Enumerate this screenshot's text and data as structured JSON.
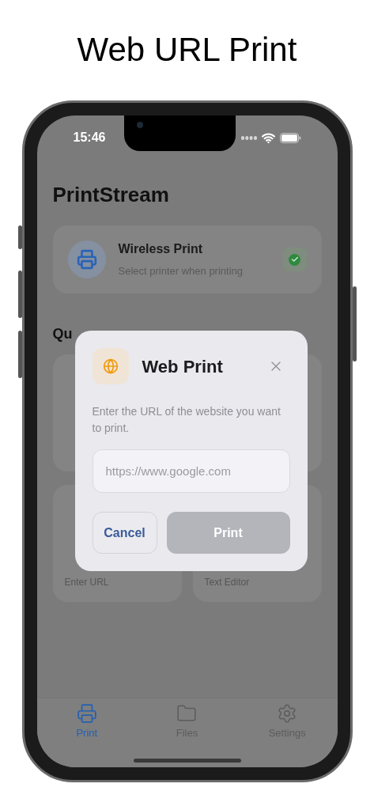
{
  "page_title": "Web URL Print",
  "status_bar": {
    "time": "15:46"
  },
  "app_title": "PrintStream",
  "printer_card": {
    "title": "Wireless Print",
    "subtitle": "Select printer when printing",
    "checked": true
  },
  "section_heading": "Qu",
  "action_cards": [
    {
      "kind": "covered"
    },
    {
      "kind": "covered"
    },
    {
      "kind": "text",
      "subtitle": "Enter URL"
    },
    {
      "kind": "text",
      "subtitle": "Text Editor"
    }
  ],
  "dialog": {
    "title": "Web Print",
    "message": "Enter the URL of the website you want to print.",
    "url_field": {
      "placeholder": "https://www.google.com"
    },
    "buttons": [
      {
        "label": "Cancel",
        "kind": "secondary",
        "disabled": false
      },
      {
        "label": "Print",
        "kind": "primary",
        "disabled": true
      }
    ]
  },
  "tabs": [
    {
      "label": "Print",
      "selected": true
    },
    {
      "label": "Files",
      "selected": false
    },
    {
      "label": "Settings",
      "selected": false
    }
  ]
}
